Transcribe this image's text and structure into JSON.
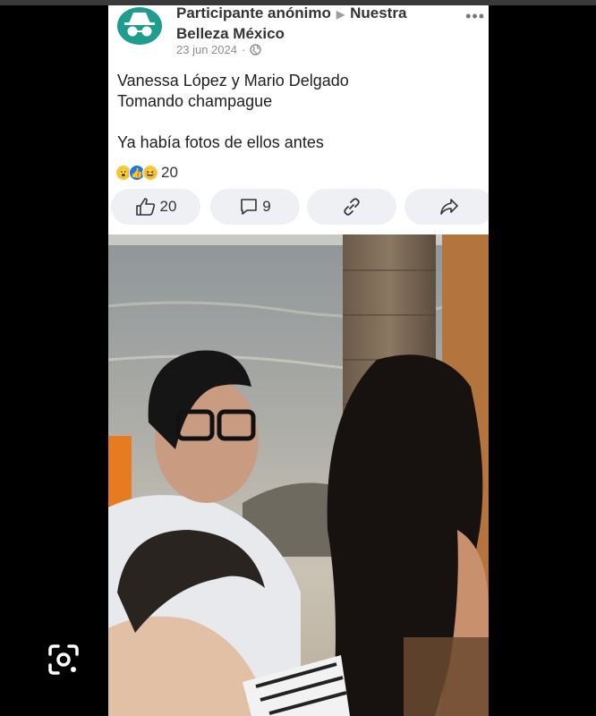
{
  "post": {
    "poster_name": "Participante anónimo",
    "group_name": "Nuestra Belleza México",
    "date": "23 jun 2024",
    "more_icon": "more-dots-icon",
    "text_lines": [
      "Vanessa López y Mario Delgado",
      "Tomando champague",
      "",
      "Ya había fotos de ellos antes"
    ],
    "reactions": {
      "icons": [
        "wow-icon",
        "like-icon",
        "haha-icon"
      ],
      "count": "20"
    }
  },
  "actions": {
    "like_count": "20",
    "comment_count": "9"
  },
  "colors": {
    "avatar": "#1e9c8e",
    "pill_bg": "#eef0f3",
    "like_blue": "#1877f2"
  }
}
